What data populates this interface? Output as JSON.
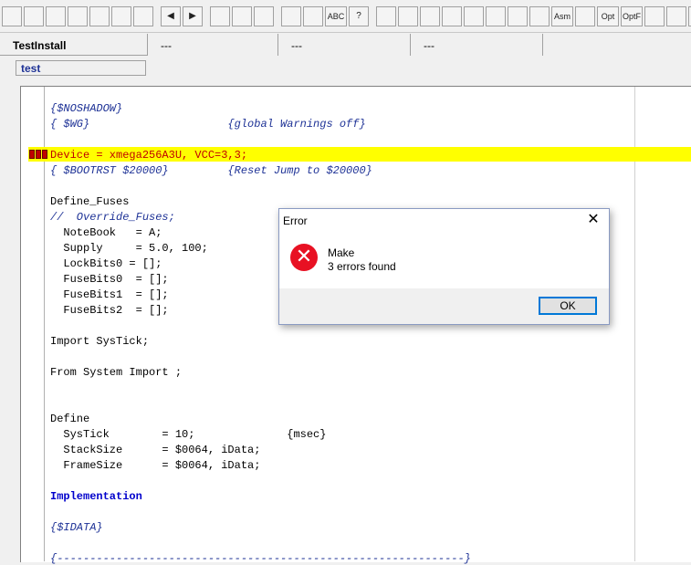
{
  "toolbar": {
    "buttons": [
      {
        "icon": "cut-icon",
        "label": ""
      },
      {
        "icon": "window-split-icon",
        "label": ""
      },
      {
        "icon": "window-icon",
        "label": ""
      },
      {
        "icon": "find-icon",
        "label": ""
      },
      {
        "icon": "replace-icon",
        "label": ""
      },
      {
        "icon": "undo-icon",
        "label": ""
      },
      {
        "icon": "magic-icon",
        "label": ""
      },
      {
        "icon": "arrow-left-icon",
        "label": "◀"
      },
      {
        "icon": "arrow-right-icon",
        "label": "▶"
      },
      {
        "icon": "page-icon",
        "label": ""
      },
      {
        "icon": "document-icon",
        "label": ""
      },
      {
        "icon": "tools-icon",
        "label": ""
      },
      {
        "icon": "calculator-icon",
        "label": ""
      },
      {
        "icon": "pen-icon",
        "label": ""
      },
      {
        "icon": "spellcheck-icon",
        "label": "ABC"
      },
      {
        "icon": "help-icon",
        "label": "?"
      },
      {
        "icon": "key-icon",
        "label": ""
      },
      {
        "icon": "hammer-icon",
        "label": ""
      },
      {
        "icon": "build-icon",
        "label": ""
      },
      {
        "icon": "stairs-icon",
        "label": ""
      },
      {
        "icon": "funnel-icon",
        "label": ""
      },
      {
        "icon": "chip-icon",
        "label": ""
      },
      {
        "icon": "bug-icon",
        "label": ""
      },
      {
        "icon": "truck-icon",
        "label": ""
      },
      {
        "icon": "asm-icon",
        "label": "Asm"
      },
      {
        "icon": "chip2-icon",
        "label": ""
      },
      {
        "icon": "opt-icon",
        "label": "Opt"
      },
      {
        "icon": "optf-icon",
        "label": "OptF"
      },
      {
        "icon": "minus-icon",
        "label": ""
      },
      {
        "icon": "image-icon",
        "label": ""
      },
      {
        "icon": "font-icon",
        "label": "A"
      }
    ]
  },
  "tabs": [
    {
      "label": "TestInstall",
      "active": true
    },
    {
      "label": "---",
      "active": false
    },
    {
      "label": "---",
      "active": false
    },
    {
      "label": "---",
      "active": false
    }
  ],
  "subtab": {
    "label": "test"
  },
  "code": {
    "lines": [
      {
        "text": "{$NOSHADOW}",
        "style": "cmt"
      },
      {
        "text": "{ $WG}                     {global Warnings off}",
        "style": "cmt"
      },
      {
        "text": "",
        "style": "kw"
      },
      {
        "text": "Device = xmega256A3U, VCC=3,3;",
        "style": "red"
      },
      {
        "text": "{ $BOOTRST $20000}         {Reset Jump to $20000}",
        "style": "cmt"
      },
      {
        "text": "",
        "style": "kw"
      },
      {
        "text": "Define_Fuses",
        "style": "kw"
      },
      {
        "text": "//  Override_Fuses;",
        "style": "cmt"
      },
      {
        "text": "  NoteBook   = A;",
        "style": "kw"
      },
      {
        "text": "  Supply     = 5.0, 100;",
        "style": "kw"
      },
      {
        "text": "  LockBits0 = [];",
        "style": "kw"
      },
      {
        "text": "  FuseBits0  = [];",
        "style": "kw"
      },
      {
        "text": "  FuseBits1  = [];",
        "style": "kw"
      },
      {
        "text": "  FuseBits2  = [];",
        "style": "kw"
      },
      {
        "text": "",
        "style": "kw"
      },
      {
        "text": "Import SysTick;",
        "style": "kw"
      },
      {
        "text": "",
        "style": "kw"
      },
      {
        "text": "From System Import ;",
        "style": "kw"
      },
      {
        "text": "",
        "style": "kw"
      },
      {
        "text": "",
        "style": "kw"
      },
      {
        "text": "Define",
        "style": "kw"
      },
      {
        "text": "  SysTick        = 10;              {msec}",
        "style": "kw"
      },
      {
        "text": "  StackSize      = $0064, iData;",
        "style": "kw"
      },
      {
        "text": "  FrameSize      = $0064, iData;",
        "style": "kw"
      },
      {
        "text": "",
        "style": "kw"
      },
      {
        "text": "Implementation",
        "style": "blue"
      },
      {
        "text": "",
        "style": "kw"
      },
      {
        "text": "{$IDATA}",
        "style": "cmt"
      },
      {
        "text": "",
        "style": "kw"
      },
      {
        "text": "{--------------------------------------------------------------}",
        "style": "cmt"
      }
    ]
  },
  "dialog": {
    "title": "Error",
    "close_label": "✕",
    "icon": "error-icon",
    "message_title": "Make",
    "message_detail": "3 errors found",
    "ok_label": "OK"
  }
}
